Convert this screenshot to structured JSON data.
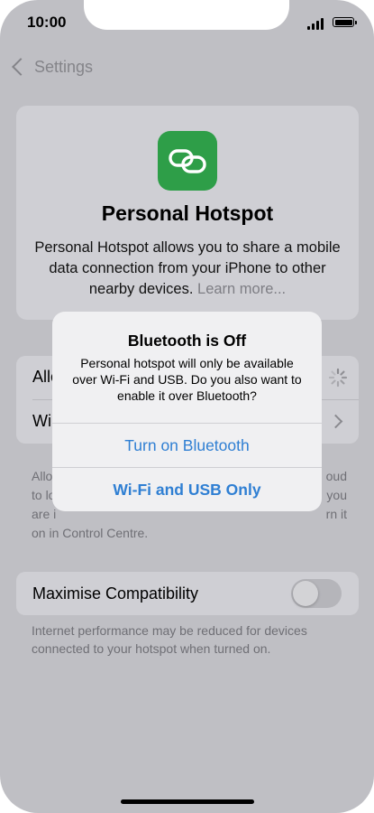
{
  "status_bar": {
    "time": "10:00"
  },
  "nav": {
    "back_label": "Settings"
  },
  "hero": {
    "title": "Personal Hotspot",
    "description": "Personal Hotspot allows you to share a mobile data connection from your iPhone to other nearby devices.",
    "learn_more": "Learn more...",
    "icon": "chain-link-icon",
    "icon_color": "#2e9e48"
  },
  "settings_rows": [
    {
      "label": "Allo"
    },
    {
      "label": "Wi"
    }
  ],
  "footnote_allow": [
    "Allo",
    "to lo",
    "are i",
    "on in Control Centre."
  ],
  "footnote_allow_right": [
    "oud",
    "you",
    "rn it"
  ],
  "maximise": {
    "label": "Maximise Compatibility",
    "enabled": false,
    "footnote": "Internet performance may be reduced for devices connected to your hotspot when turned on."
  },
  "alert": {
    "title": "Bluetooth is Off",
    "message": "Personal hotspot will only be available over Wi-Fi and USB. Do you also want to enable it over Bluetooth?",
    "buttons": [
      {
        "label": "Turn on Bluetooth"
      },
      {
        "label": "Wi-Fi and USB Only"
      }
    ],
    "accent_color": "#2f7fd3"
  }
}
